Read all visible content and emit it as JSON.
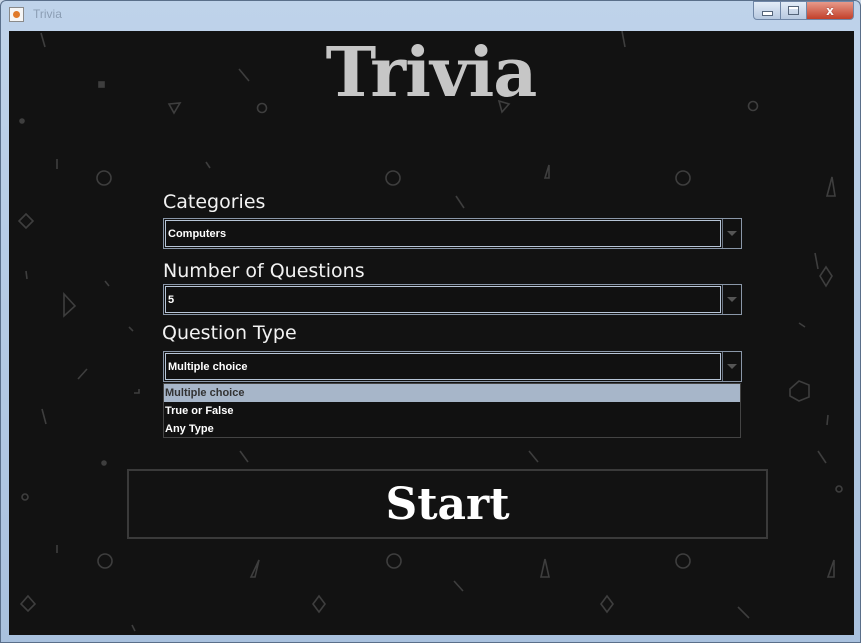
{
  "window": {
    "title": "Trivia",
    "controls": {
      "minimize": "–",
      "maximize": "□",
      "close": "x"
    }
  },
  "app": {
    "title": "Trivia",
    "categories": {
      "label": "Categories",
      "value": "Computers"
    },
    "num_questions": {
      "label": "Number of Questions",
      "value": "5"
    },
    "question_type": {
      "label": "Question Type",
      "value": "Multiple choice",
      "options": [
        "Multiple choice",
        "True or False",
        "Any Type"
      ],
      "selected_index": 0
    },
    "start_label": "Start"
  },
  "colors": {
    "background": "#121212",
    "title": "#c6c6c6",
    "option_highlight": "#a7b6c9",
    "combo_border": "#b7c5d7"
  }
}
